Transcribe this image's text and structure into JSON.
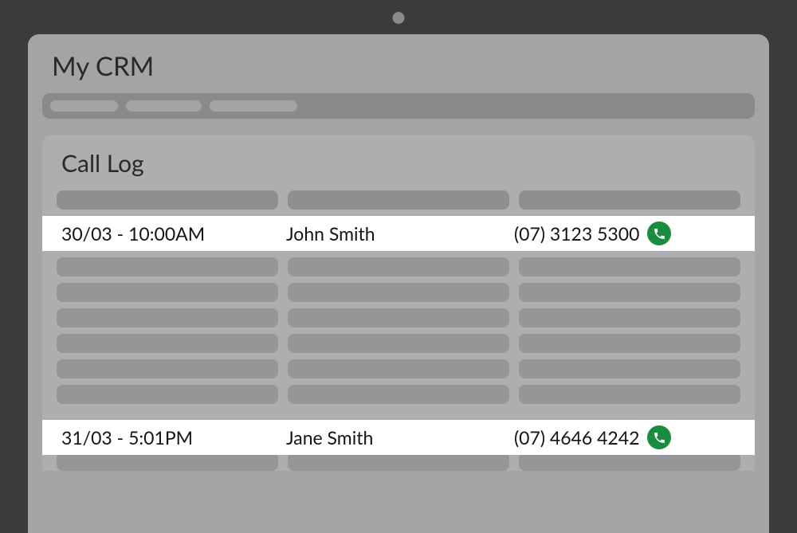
{
  "app": {
    "title": "My CRM"
  },
  "panel": {
    "title": "Call Log"
  },
  "rows": [
    {
      "datetime": "30/03 - 10:00AM",
      "name": "John Smith",
      "phone": "(07) 3123 5300"
    },
    {
      "datetime": "31/03 - 5:01PM",
      "name": "Jane Smith",
      "phone": "(07) 4646 4242"
    }
  ],
  "colors": {
    "call_button": "#1b8c3d"
  }
}
